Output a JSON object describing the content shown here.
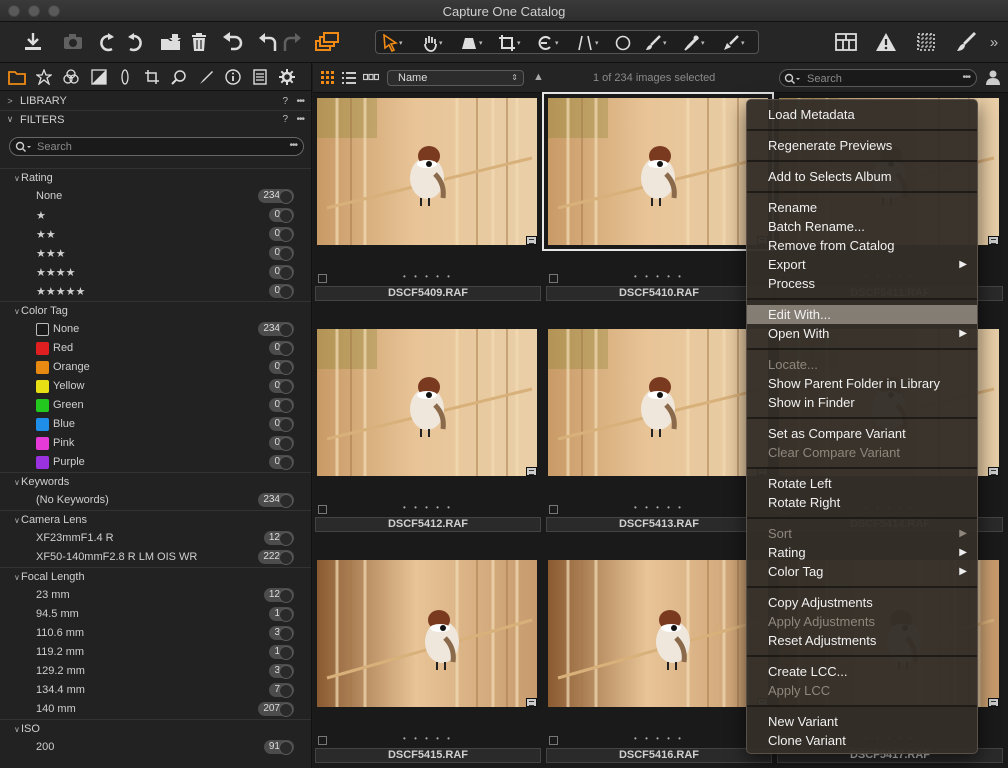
{
  "window": {
    "title": "Capture One Catalog"
  },
  "toolbar": {
    "left_icons": [
      "import-icon",
      "camera-icon",
      "rotate-left-icon",
      "rotate-right-icon",
      "move-to-folder-icon",
      "trash-icon",
      "undo-icon",
      "undo-arrow-icon",
      "redo-arrow-icon",
      "variants-stack-icon"
    ],
    "cursor_tools": [
      "select-cursor-icon",
      "pan-hand-icon",
      "keystone-icon",
      "crop-icon",
      "rotate-straighten-icon",
      "spot-lines-icon",
      "circle-icon",
      "brush-icon",
      "picker-icon",
      "eraser-icon"
    ],
    "right_icons": [
      "grid-layout-icon",
      "warning-icon",
      "focus-grid-icon",
      "brush-tool-icon",
      "more-chevrons-icon"
    ]
  },
  "left_panel": {
    "tabs": [
      "library-folder-icon",
      "star-icon",
      "color-circles-icon",
      "exposure-icon",
      "lens-icon",
      "crop-tab-icon",
      "details-icon",
      "adjust-pen-icon",
      "info-icon",
      "metadata-icon",
      "settings-gear-icon"
    ],
    "library_header": "LIBRARY",
    "filters_header": "FILTERS",
    "help_label": "?",
    "more_label": "•••",
    "search_placeholder": "Search",
    "groups": [
      {
        "title": "Rating",
        "rows": [
          {
            "label": "None",
            "count": "234"
          },
          {
            "label": "★",
            "count": "0"
          },
          {
            "label": "★★",
            "count": "0"
          },
          {
            "label": "★★★",
            "count": "0"
          },
          {
            "label": "★★★★",
            "count": "0"
          },
          {
            "label": "★★★★★",
            "count": "0"
          }
        ]
      },
      {
        "title": "Color Tag",
        "rows": [
          {
            "label": "None",
            "count": "234",
            "color": "#1a1a1a"
          },
          {
            "label": "Red",
            "count": "0",
            "color": "#e02020"
          },
          {
            "label": "Orange",
            "count": "0",
            "color": "#e88a12"
          },
          {
            "label": "Yellow",
            "count": "0",
            "color": "#e8e014"
          },
          {
            "label": "Green",
            "count": "0",
            "color": "#22c81e"
          },
          {
            "label": "Blue",
            "count": "0",
            "color": "#1e8ee8"
          },
          {
            "label": "Pink",
            "count": "0",
            "color": "#e63ad8"
          },
          {
            "label": "Purple",
            "count": "0",
            "color": "#9a32e0"
          }
        ]
      },
      {
        "title": "Keywords",
        "rows": [
          {
            "label": "(No Keywords)",
            "count": "234"
          }
        ]
      },
      {
        "title": "Camera Lens",
        "rows": [
          {
            "label": "XF23mmF1.4 R",
            "count": "12"
          },
          {
            "label": "XF50-140mmF2.8 R LM OIS WR",
            "count": "222"
          }
        ]
      },
      {
        "title": "Focal Length",
        "rows": [
          {
            "label": "23 mm",
            "count": "12"
          },
          {
            "label": "94.5 mm",
            "count": "1"
          },
          {
            "label": "110.6 mm",
            "count": "3"
          },
          {
            "label": "119.2 mm",
            "count": "1"
          },
          {
            "label": "129.2 mm",
            "count": "3"
          },
          {
            "label": "134.4 mm",
            "count": "7"
          },
          {
            "label": "140 mm",
            "count": "207"
          }
        ]
      },
      {
        "title": "ISO",
        "rows": [
          {
            "label": "200",
            "count": "91"
          }
        ]
      }
    ]
  },
  "browser": {
    "sort_field": "Name",
    "selection_status": "1 of 234 images selected",
    "search_placeholder": "Search",
    "thumbnails": [
      {
        "filename": "DSCF5409.RAF",
        "rating_dots": "• • • • •",
        "selected": false
      },
      {
        "filename": "DSCF5410.RAF",
        "rating_dots": "• • • • •",
        "selected": true
      },
      {
        "filename": "DSCF5411.RAF",
        "rating_dots": "• • • • •",
        "selected": false
      },
      {
        "filename": "DSCF5412.RAF",
        "rating_dots": "• • • • •",
        "selected": false
      },
      {
        "filename": "DSCF5413.RAF",
        "rating_dots": "• • • • •",
        "selected": false
      },
      {
        "filename": "DSCF5414.RAF",
        "rating_dots": "• • • • •",
        "selected": false
      },
      {
        "filename": "DSCF5415.RAF",
        "rating_dots": "• • • • •",
        "selected": false
      },
      {
        "filename": "DSCF5416.RAF",
        "rating_dots": "• • • • •",
        "selected": false
      },
      {
        "filename": "DSCF5417.RAF",
        "rating_dots": "• • • • •",
        "selected": false
      }
    ]
  },
  "context_menu": {
    "groups": [
      [
        {
          "label": "Load Metadata"
        }
      ],
      [
        {
          "label": "Regenerate Previews"
        }
      ],
      [
        {
          "label": "Add to Selects Album"
        }
      ],
      [
        {
          "label": "Rename"
        },
        {
          "label": "Batch Rename..."
        },
        {
          "label": "Remove from Catalog"
        },
        {
          "label": "Export",
          "submenu": true
        },
        {
          "label": "Process"
        }
      ],
      [
        {
          "label": "Edit With...",
          "highlighted": true
        },
        {
          "label": "Open With",
          "submenu": true
        }
      ],
      [
        {
          "label": "Locate...",
          "disabled": true
        },
        {
          "label": "Show Parent Folder in Library"
        },
        {
          "label": "Show in Finder"
        }
      ],
      [
        {
          "label": "Set as Compare Variant"
        },
        {
          "label": "Clear Compare Variant",
          "disabled": true
        }
      ],
      [
        {
          "label": "Rotate Left"
        },
        {
          "label": "Rotate Right"
        }
      ],
      [
        {
          "label": "Sort",
          "submenu": true,
          "disabled": true
        },
        {
          "label": "Rating",
          "submenu": true
        },
        {
          "label": "Color Tag",
          "submenu": true
        }
      ],
      [
        {
          "label": "Copy Adjustments"
        },
        {
          "label": "Apply Adjustments",
          "disabled": true
        },
        {
          "label": "Reset Adjustments"
        }
      ],
      [
        {
          "label": "Create LCC..."
        },
        {
          "label": "Apply LCC",
          "disabled": true
        }
      ],
      [
        {
          "label": "New Variant"
        },
        {
          "label": "Clone Variant"
        }
      ]
    ]
  }
}
